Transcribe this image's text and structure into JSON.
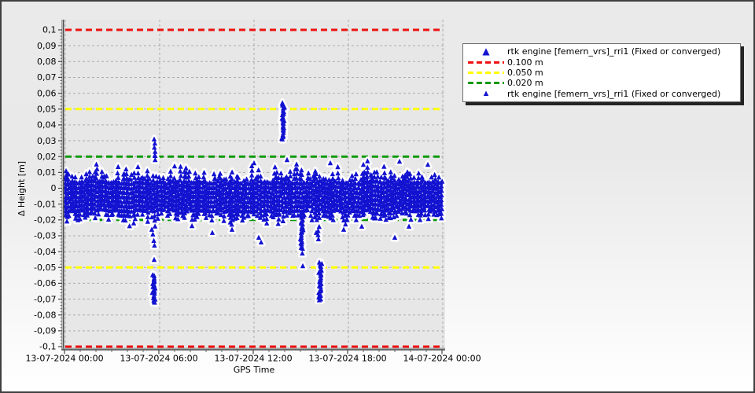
{
  "chart_data": {
    "type": "scatter",
    "title": "",
    "xlabel": "GPS Time",
    "ylabel": "Δ Height [m]",
    "plot_bg": "#e7e7e7",
    "grid": {
      "color": "#ababab",
      "dashed": true,
      "horizontal_step": 0.01,
      "vertical_step_hours": 6
    },
    "ylim": [
      -0.1,
      0.1
    ],
    "x_range_hours": [
      0,
      24
    ],
    "x_ticks": [
      {
        "hour": 0,
        "label": "13-07-2024 00:00"
      },
      {
        "hour": 6,
        "label": "13-07-2024 06:00"
      },
      {
        "hour": 12,
        "label": "13-07-2024 12:00"
      },
      {
        "hour": 18,
        "label": "13-07-2024 18:00"
      },
      {
        "hour": 24,
        "label": "14-07-2024 00:00"
      }
    ],
    "y_ticks": [
      {
        "value": 0.1,
        "label": "0,1"
      },
      {
        "value": 0.09,
        "label": "0,09"
      },
      {
        "value": 0.08,
        "label": "0,08"
      },
      {
        "value": 0.07,
        "label": "0,07"
      },
      {
        "value": 0.06,
        "label": "0,06"
      },
      {
        "value": 0.05,
        "label": "0,05"
      },
      {
        "value": 0.04,
        "label": "0,04"
      },
      {
        "value": 0.03,
        "label": "0,03"
      },
      {
        "value": 0.02,
        "label": "0,02"
      },
      {
        "value": 0.01,
        "label": "0,01"
      },
      {
        "value": 0,
        "label": "0"
      },
      {
        "value": -0.01,
        "label": "-0,01"
      },
      {
        "value": -0.02,
        "label": "-0,02"
      },
      {
        "value": -0.03,
        "label": "-0,03"
      },
      {
        "value": -0.04,
        "label": "-0,04"
      },
      {
        "value": -0.05,
        "label": "-0,05"
      },
      {
        "value": -0.06,
        "label": "-0,06"
      },
      {
        "value": -0.07,
        "label": "-0,07"
      },
      {
        "value": -0.08,
        "label": "-0,08"
      },
      {
        "value": -0.09,
        "label": "-0,09"
      },
      {
        "value": -0.1,
        "label": "-0,1"
      }
    ],
    "thresholds": [
      {
        "label": "0.100 m",
        "values": [
          0.1,
          -0.1
        ],
        "color": "#ee1111"
      },
      {
        "label": "0.050 m",
        "values": [
          0.05,
          -0.05
        ],
        "color": "#ffff00"
      },
      {
        "label": "0.020 m",
        "values": [
          0.02,
          -0.02
        ],
        "color": "#089a08"
      }
    ],
    "series": [
      {
        "name": "rtk engine [femern_vrs]_rri1 (Fixed or converged)",
        "marker": "triangle",
        "color": "#1212d0",
        "band": {
          "hours": [
            0,
            24
          ],
          "core_top": 0.005,
          "peak_max": 0.016,
          "core_bottom": -0.015,
          "bottom_dips": -0.027
        },
        "clusters": [
          {
            "hour": 5.72,
            "from": 0.018,
            "to": 0.0335,
            "density": "sparse"
          },
          {
            "hour": 5.68,
            "from": -0.072,
            "to": -0.054,
            "density": "dense"
          },
          {
            "hour": 13.9,
            "from": 0.031,
            "to": 0.0535,
            "density": "dense"
          },
          {
            "hour": 15.1,
            "from": -0.038,
            "to": -0.015,
            "density": "dense"
          },
          {
            "hour": 16.25,
            "from": -0.0705,
            "to": -0.046,
            "density": "dense"
          },
          {
            "hour": 16.15,
            "from": -0.032,
            "to": -0.022,
            "density": "sparse"
          }
        ],
        "outliers": [
          [
            0.1,
            0.011
          ],
          [
            0.1,
            0.008
          ],
          [
            0.12,
            0.006
          ],
          [
            4.4,
            -0.022
          ],
          [
            5.55,
            -0.026
          ],
          [
            5.62,
            -0.029
          ],
          [
            5.68,
            -0.033
          ],
          [
            5.72,
            -0.036
          ],
          [
            5.7,
            -0.045
          ],
          [
            9.4,
            -0.028
          ],
          [
            10.65,
            -0.026
          ],
          [
            12.35,
            -0.031
          ],
          [
            12.5,
            -0.034
          ],
          [
            15.12,
            -0.041
          ],
          [
            15.15,
            -0.049
          ],
          [
            16.0,
            -0.028
          ],
          [
            17.75,
            -0.026
          ],
          [
            18.9,
            -0.024
          ],
          [
            21.0,
            -0.031
          ],
          [
            21.9,
            -0.024
          ],
          [
            5.75,
            0.021
          ],
          [
            7.0,
            0.014
          ],
          [
            12.05,
            0.016
          ],
          [
            14.15,
            0.018
          ],
          [
            16.9,
            0.016
          ],
          [
            19.0,
            0.015
          ],
          [
            21.3,
            0.017
          ],
          [
            23.1,
            0.015
          ]
        ]
      }
    ]
  },
  "legend": {
    "entries": [
      {
        "marker": "triangle-large",
        "color": "#1212d0",
        "label": "rtk engine [femern_vrs]_rri1 (Fixed or converged)"
      },
      {
        "marker": "dash",
        "color": "#ee1111",
        "label": "0.100 m"
      },
      {
        "marker": "dash",
        "color": "#ffff00",
        "label": "0.050 m"
      },
      {
        "marker": "dash",
        "color": "#089a08",
        "label": "0.020 m"
      },
      {
        "marker": "triangle-small",
        "color": "#1212d0",
        "label": "rtk engine [femern_vrs]_rri1 (Fixed or converged)"
      }
    ]
  }
}
